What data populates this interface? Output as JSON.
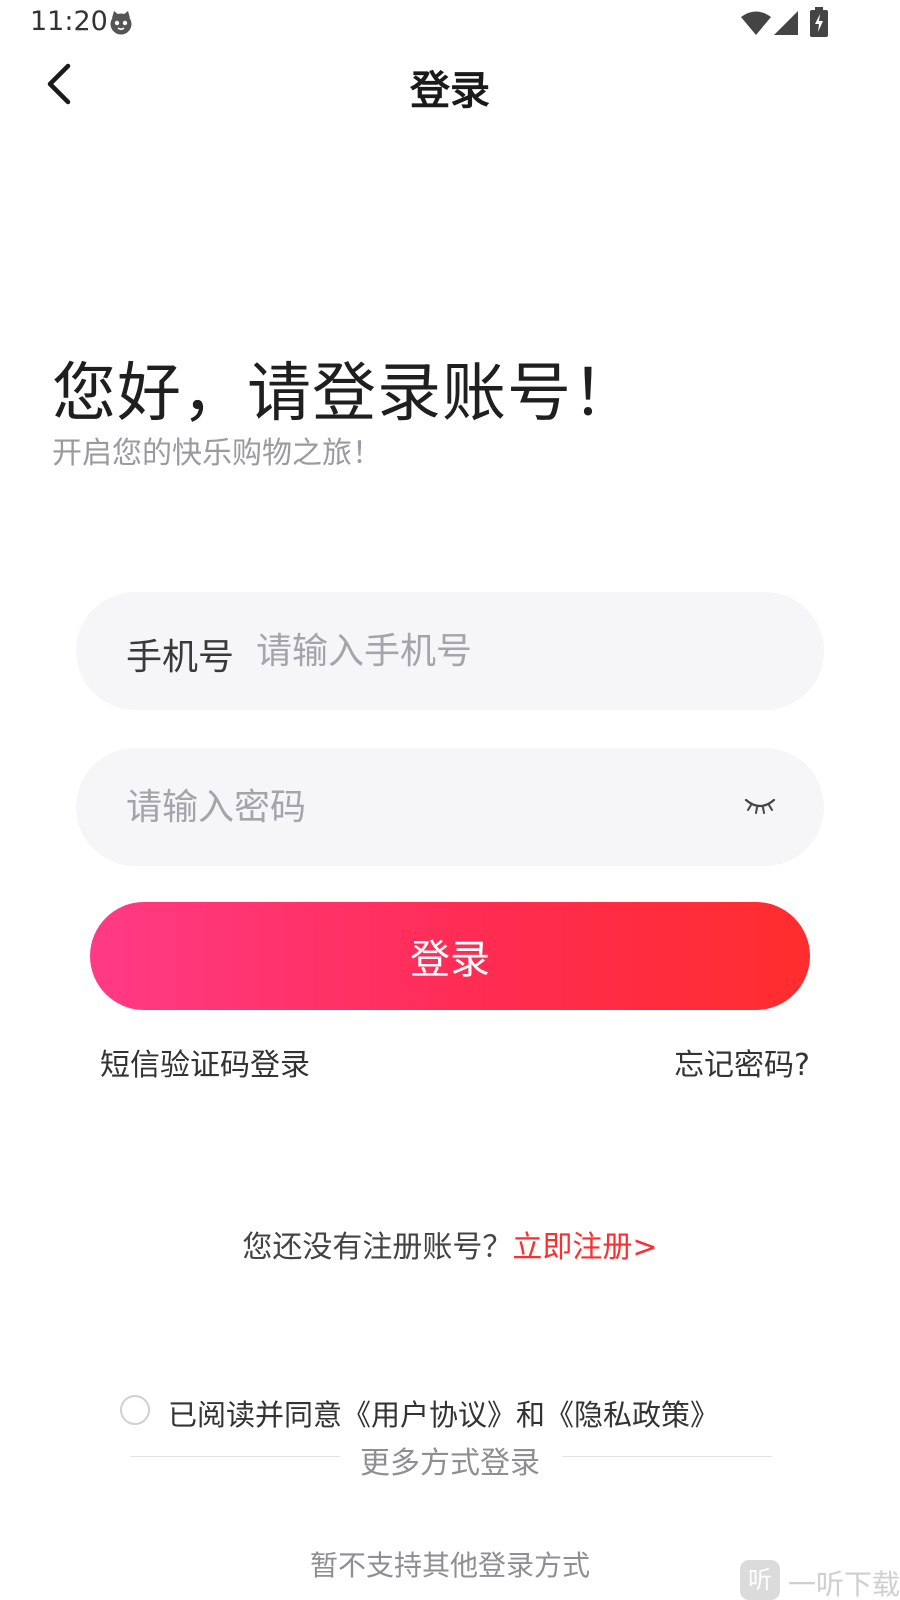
{
  "status_bar": {
    "time": "11:20",
    "icons": [
      "cat-face-icon",
      "wifi-icon",
      "cell-signal-icon",
      "battery-charging-icon"
    ]
  },
  "nav": {
    "title": "登录",
    "back_icon": "chevron-left-icon"
  },
  "greeting": {
    "title": "您好，请登录账号！",
    "subtitle": "开启您的快乐购物之旅！"
  },
  "form": {
    "phone_label": "手机号",
    "phone_placeholder": "请输入手机号",
    "phone_value": "",
    "password_placeholder": "请输入密码",
    "password_value": "",
    "eye_icon": "eye-closed-icon",
    "login_label": "登录",
    "sms_login": "短信验证码登录",
    "forgot_password": "忘记密码?"
  },
  "register": {
    "prompt": "您还没有注册账号？",
    "link": "立即注册>"
  },
  "agreement": {
    "checked": false,
    "text": "已阅读并同意《用户协议》和《隐私政策》"
  },
  "other_login": {
    "title": "更多方式登录",
    "note": "暂不支持其他登录方式"
  },
  "watermark": {
    "logo_text": "听",
    "text": "一听下载"
  },
  "colors": {
    "accent_start": "#ff3a86",
    "accent_end": "#ff2d2d",
    "link": "#ff2d2d",
    "field_bg": "#f6f6f8"
  }
}
